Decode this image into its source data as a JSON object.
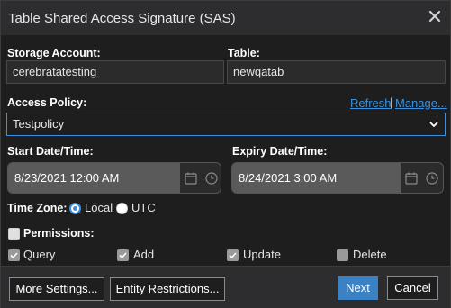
{
  "dialog": {
    "title": "Table Shared Access Signature (SAS)"
  },
  "storage_account": {
    "label": "Storage Account:",
    "value": "cerebratatesting"
  },
  "table": {
    "label": "Table:",
    "value": "newqatab"
  },
  "access_policy": {
    "label": "Access Policy:",
    "refresh_label": "Refresh",
    "separator": "|",
    "manage_label": "Manage...",
    "selected": "Testpolicy"
  },
  "start": {
    "label": "Start Date/Time:",
    "value": "8/23/2021 12:00 AM"
  },
  "expiry": {
    "label": "Expiry Date/Time:",
    "value": "8/24/2021 3:00 AM"
  },
  "timezone": {
    "label": "Time Zone:",
    "options": [
      "Local",
      "UTC"
    ],
    "selected": "Local"
  },
  "permissions": {
    "label": "Permissions:",
    "items": [
      {
        "label": "Query",
        "checked": true
      },
      {
        "label": "Add",
        "checked": true
      },
      {
        "label": "Update",
        "checked": true
      },
      {
        "label": "Delete",
        "checked": false
      }
    ]
  },
  "footer": {
    "more_settings": "More Settings...",
    "entity_restrictions": "Entity Restrictions...",
    "next": "Next",
    "cancel": "Cancel"
  },
  "colors": {
    "accent": "#3b8fdb",
    "primary_button": "#3b82c4",
    "background": "#1e1e1e",
    "titlebar": "#2d2d30"
  },
  "icons": {
    "close": "close-icon",
    "dropdown": "chevron-down-icon",
    "calendar": "calendar-icon",
    "clock": "clock-icon"
  }
}
